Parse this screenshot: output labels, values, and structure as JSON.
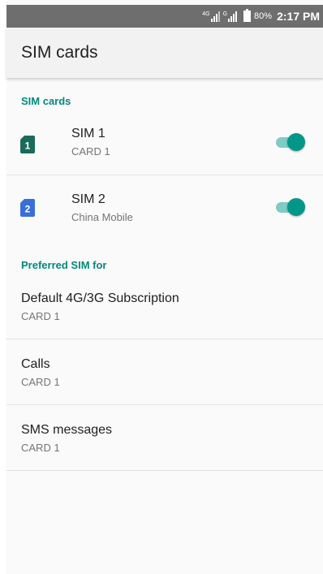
{
  "status_bar": {
    "sim1_network_tag": "4G",
    "sim2_network_tag": "G",
    "battery_percent": "80%",
    "time": "2:17 PM"
  },
  "app_bar": {
    "title": "SIM cards"
  },
  "sim_section": {
    "header": "SIM cards",
    "sims": [
      {
        "icon_number": "1",
        "title": "SIM 1",
        "subtitle": "CARD 1",
        "enabled": true,
        "icon_color": "#1b6b5a"
      },
      {
        "icon_number": "2",
        "title": "SIM 2",
        "subtitle": "China Mobile",
        "enabled": true,
        "icon_color": "#3a6fd8"
      }
    ]
  },
  "preferred_section": {
    "header": "Preferred SIM for",
    "items": [
      {
        "title": "Default 4G/3G Subscription",
        "subtitle": "CARD 1"
      },
      {
        "title": "Calls",
        "subtitle": "CARD 1"
      },
      {
        "title": "SMS messages",
        "subtitle": "CARD 1"
      }
    ]
  },
  "colors": {
    "accent": "#009688",
    "status_bar": "#6e6e6e"
  }
}
